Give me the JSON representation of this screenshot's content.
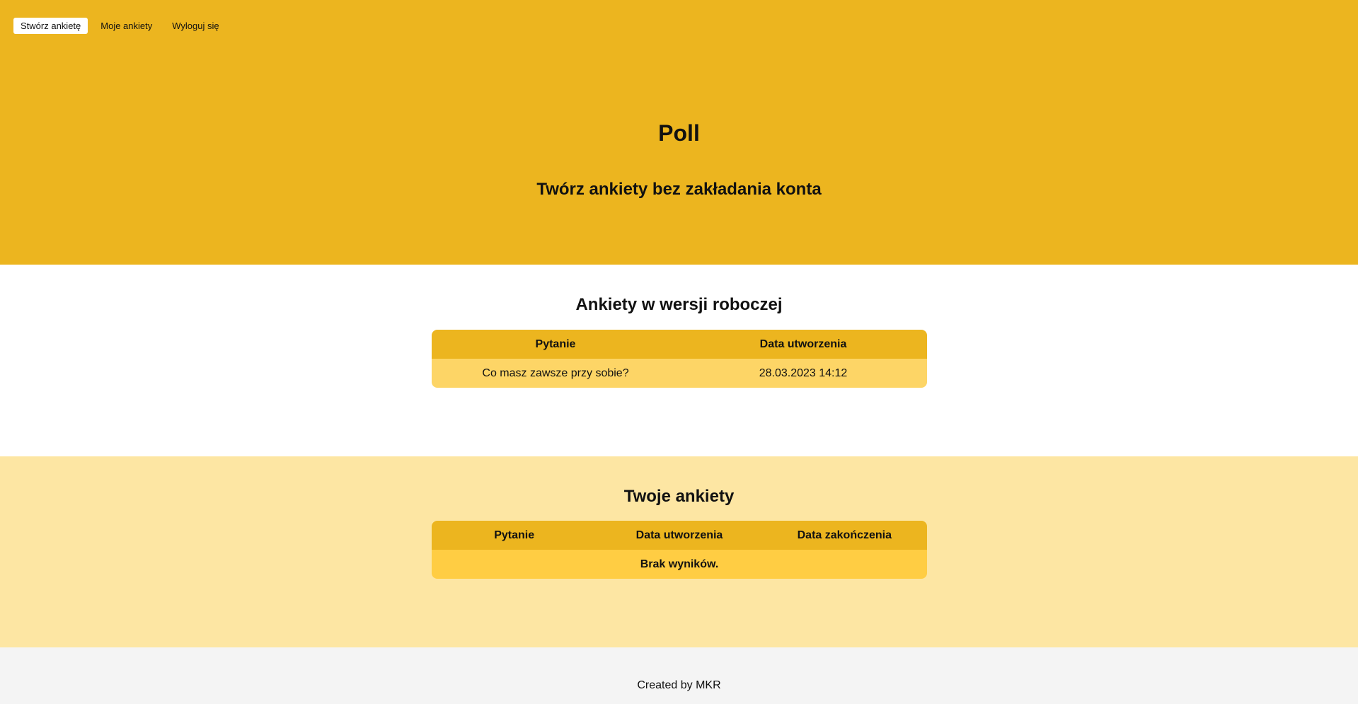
{
  "nav": {
    "items": [
      {
        "label": "Stwórz ankietę",
        "active": true
      },
      {
        "label": "Moje ankiety",
        "active": false
      },
      {
        "label": "Wyloguj się",
        "active": false
      }
    ]
  },
  "hero": {
    "title": "Poll",
    "subtitle": "Twórz ankiety bez zakładania konta"
  },
  "drafts": {
    "title": "Ankiety w wersji roboczej",
    "columns": [
      "Pytanie",
      "Data utworzenia"
    ],
    "rows": [
      {
        "question": "Co masz zawsze przy sobie?",
        "created": "28.03.2023 14:12"
      }
    ]
  },
  "mine": {
    "title": "Twoje ankiety",
    "columns": [
      "Pytanie",
      "Data utworzenia",
      "Data zakończenia"
    ],
    "empty_text": "Brak wyników."
  },
  "footer": {
    "text": "Created by MKR"
  },
  "colors": {
    "primary": "#ecb51f",
    "draft_row": "#fdd566",
    "mine_bg": "#fde6a3",
    "mine_empty_row": "#ffcd43",
    "footer_bg": "#f4f4f4"
  }
}
